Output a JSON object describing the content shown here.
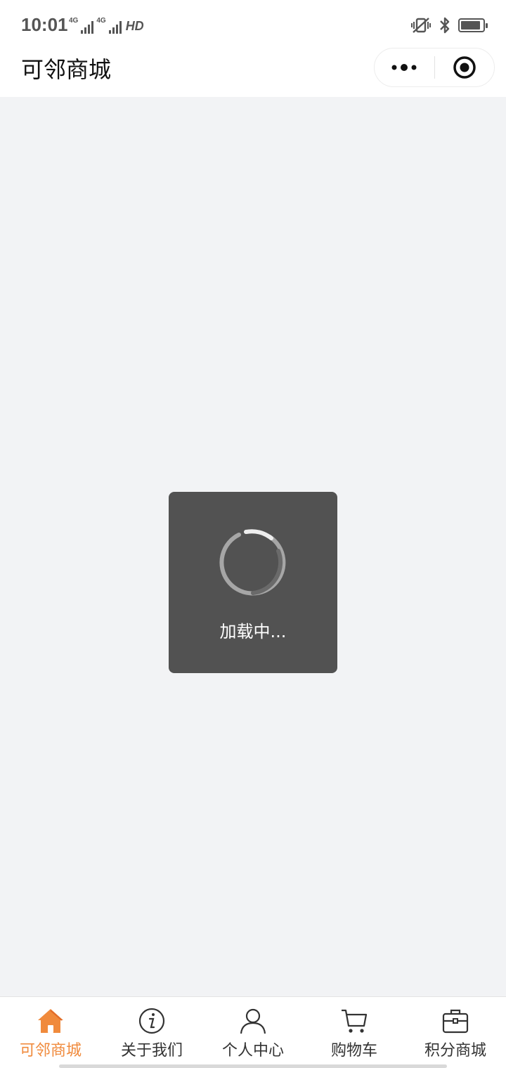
{
  "status_bar": {
    "time": "10:01",
    "network_1": "4G",
    "network_2": "4G",
    "hd_label": "HD",
    "battery_level": 0.9
  },
  "nav_bar": {
    "title": "可邻商城",
    "more_icon": "more-dots-icon",
    "close_icon": "target-circle-icon"
  },
  "loading": {
    "text": "加载中..."
  },
  "tab_bar": {
    "active_color": "#f08a3c",
    "items": [
      {
        "label": "可邻商城",
        "icon": "home-icon",
        "active": true
      },
      {
        "label": "关于我们",
        "icon": "info-icon",
        "active": false
      },
      {
        "label": "个人中心",
        "icon": "person-icon",
        "active": false
      },
      {
        "label": "购物车",
        "icon": "cart-icon",
        "active": false
      },
      {
        "label": "积分商城",
        "icon": "briefcase-icon",
        "active": false
      }
    ]
  }
}
